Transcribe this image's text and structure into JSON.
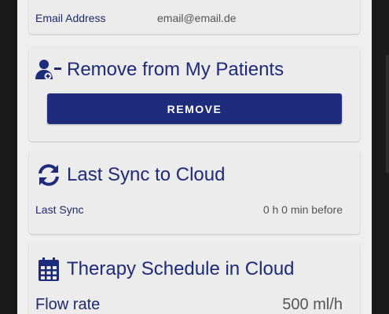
{
  "email": {
    "label": "Email Address",
    "value": "email@email.de"
  },
  "remove_card": {
    "title": "Remove from My Patients",
    "icon": "user-minus-icon",
    "button_label": "REMOVE"
  },
  "sync_card": {
    "title": "Last Sync to Cloud",
    "icon": "sync-icon",
    "row_label": "Last Sync",
    "row_value": "0 h 0 min before"
  },
  "therapy_card": {
    "title": "Therapy Schedule in Cloud",
    "icon": "calendar-icon",
    "flow_label": "Flow rate",
    "flow_value": "500 ml/h"
  },
  "colors": {
    "primary": "#1f2c7c",
    "title_text": "#1e2a7a",
    "background": "#efefef",
    "card": "#ececec"
  }
}
